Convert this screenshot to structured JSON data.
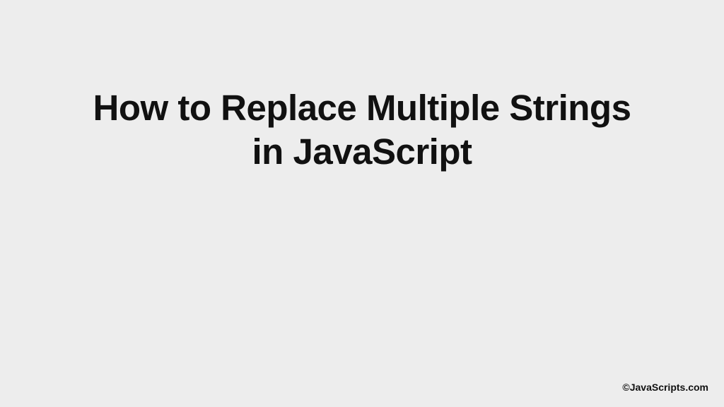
{
  "main": {
    "title": "How to Replace Multiple Strings in JavaScript"
  },
  "footer": {
    "attribution": "©JavaScripts.com"
  }
}
